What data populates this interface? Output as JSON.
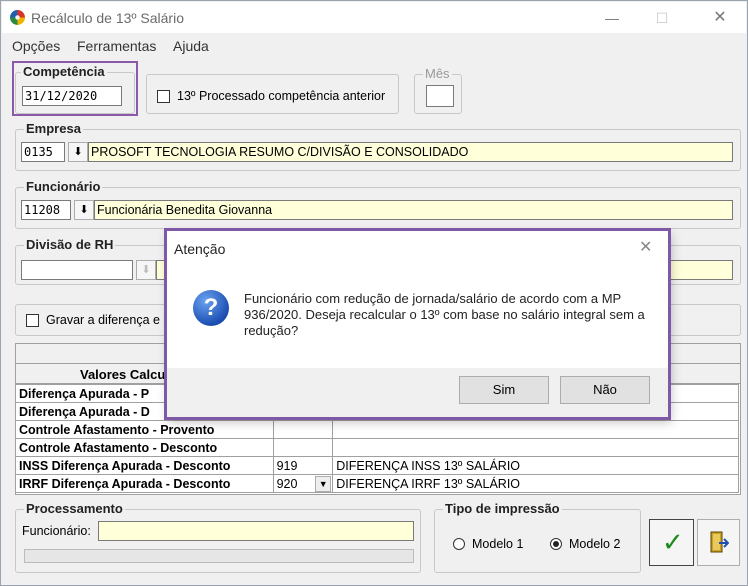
{
  "window": {
    "title": "Recálculo de 13º Salário",
    "controls": {
      "minimize": "—",
      "maximize": "☐",
      "close": "✕"
    }
  },
  "menu": {
    "items": [
      "Opções",
      "Ferramentas",
      "Ajuda"
    ]
  },
  "competencia": {
    "title": "Competência",
    "value": "31/12/2020"
  },
  "processado_anterior": {
    "label": "13º Processado competência anterior",
    "checked": false
  },
  "mes": {
    "title": "Mês",
    "value": ""
  },
  "empresa": {
    "title": "Empresa",
    "code": "0135",
    "name": "PROSOFT TECNOLOGIA RESUMO C/DIVISÃO E CONSOLIDADO"
  },
  "funcionario": {
    "title": "Funcionário",
    "code": "11208",
    "name": "Funcionária Benedita Giovanna"
  },
  "divisao": {
    "title": "Divisão de RH",
    "code": "",
    "name": ""
  },
  "gravar_diferenca": {
    "label": "Gravar a diferença e",
    "checked": false
  },
  "valores_table": {
    "header": "Valores Calcu",
    "rows": [
      {
        "label": "Diferença Apurada - P",
        "code": "",
        "desc": ""
      },
      {
        "label": "Diferença Apurada - D",
        "code": "",
        "desc": ""
      },
      {
        "label": "Controle Afastamento - Provento",
        "code": "",
        "desc": ""
      },
      {
        "label": "Controle Afastamento - Desconto",
        "code": "",
        "desc": ""
      },
      {
        "label": "INSS Diferença Apurada - Desconto",
        "code": "919",
        "desc": "DIFERENÇA INSS 13º SALÁRIO"
      },
      {
        "label": "IRRF Diferença Apurada - Desconto",
        "code": "920",
        "desc": "DIFERENÇA IRRF 13º SALÁRIO"
      }
    ]
  },
  "processamento": {
    "title": "Processamento",
    "funcionario_label": "Funcionário:",
    "funcionario_value": ""
  },
  "tipo_impressao": {
    "title": "Tipo de impressão",
    "options": [
      "Modelo 1",
      "Modelo 2"
    ],
    "selected": "Modelo 2"
  },
  "dialog": {
    "title": "Atenção",
    "message": "Funcionário com redução de jornada/salário de acordo com a MP 936/2020. Deseja recalcular o 13º com base no salário integral sem a redução?",
    "yes_label": "Sim",
    "no_label": "Não",
    "close": "✕"
  },
  "colors": {
    "highlight": "#8a5aa8",
    "input_yellow": "#ffffd9",
    "confirm_green": "#1a8a1a"
  }
}
